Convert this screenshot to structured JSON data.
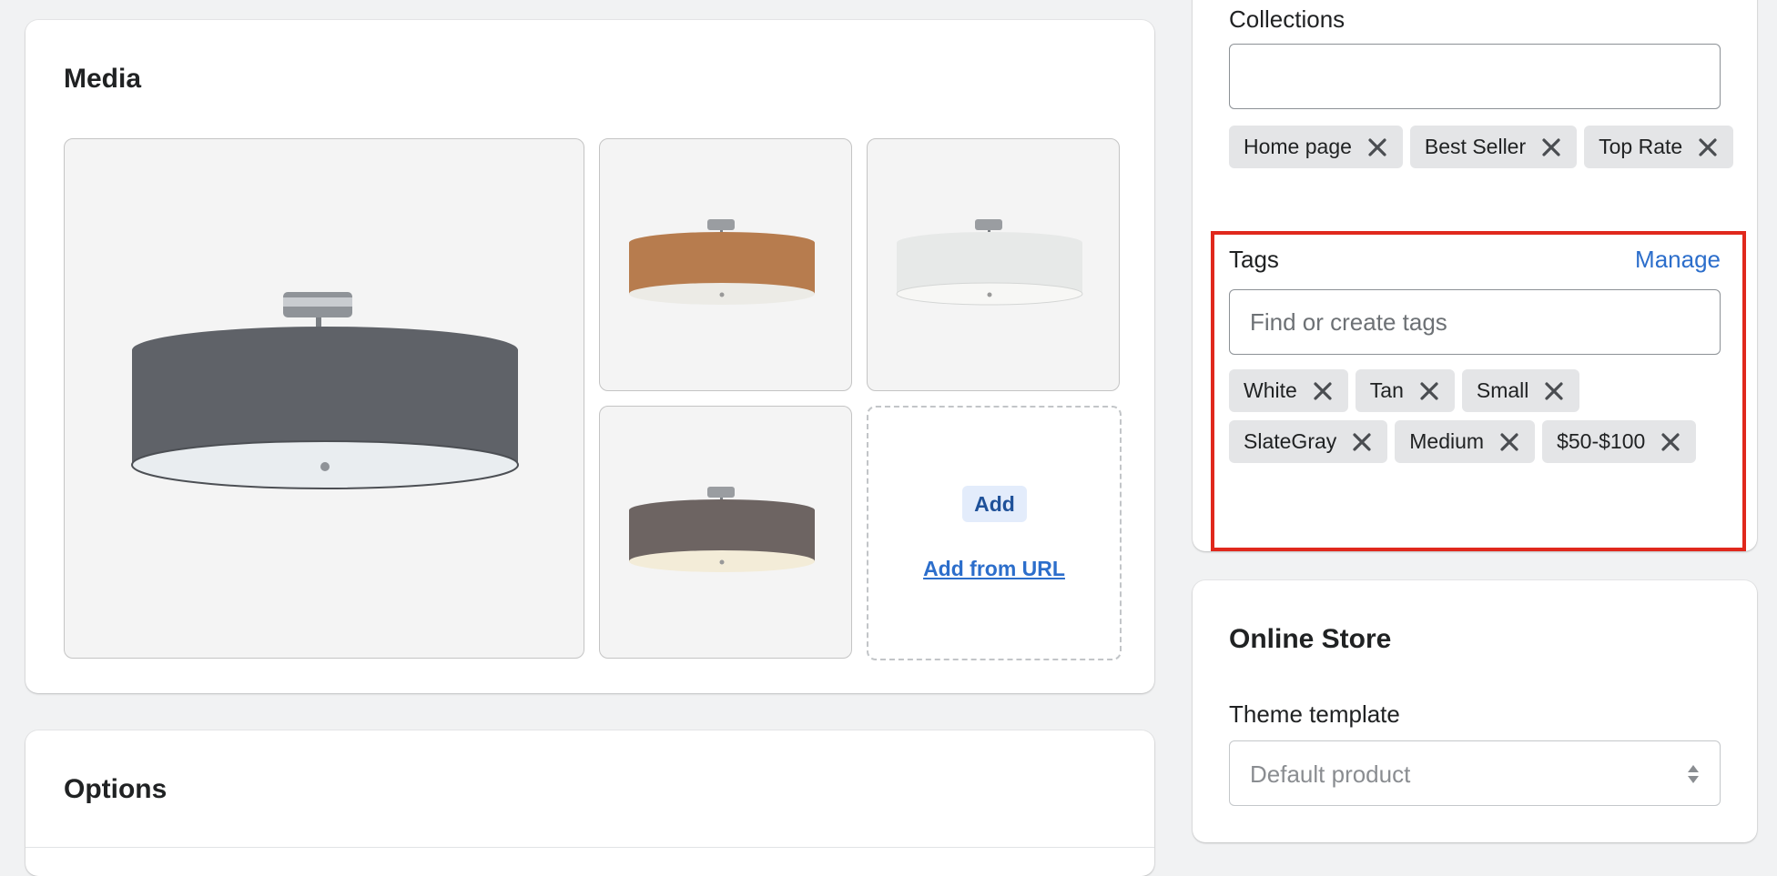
{
  "media": {
    "title": "Media",
    "images": [
      {
        "alt": "Slate gray ceiling lamp",
        "shade_color": "#5f6268"
      },
      {
        "alt": "Tan ceiling lamp",
        "shade_color": "#b77c4e"
      },
      {
        "alt": "White ceiling lamp",
        "shade_color": "#e7e9e8"
      },
      {
        "alt": "Brown gray ceiling lamp",
        "shade_color": "#6d6462"
      }
    ],
    "add_label": "Add",
    "add_from_url_label": "Add from URL"
  },
  "options": {
    "title": "Options"
  },
  "organization": {
    "collections_label": "Collections",
    "collections_input_value": "",
    "collections": [
      "Home page",
      "Best Seller",
      "Top Rate"
    ],
    "tags_label": "Tags",
    "manage_label": "Manage",
    "tags_placeholder": "Find or create tags",
    "tags": [
      "White",
      "Tan",
      "Small",
      "SlateGray",
      "Medium",
      "$50-$100"
    ]
  },
  "online_store": {
    "title": "Online Store",
    "theme_template_label": "Theme template",
    "theme_template_value": "Default product"
  },
  "colors": {
    "accent_link": "#2c6ecb",
    "highlight": "#e0281c",
    "chip_bg": "#e4e5e7",
    "page_bg": "#f1f2f3"
  }
}
